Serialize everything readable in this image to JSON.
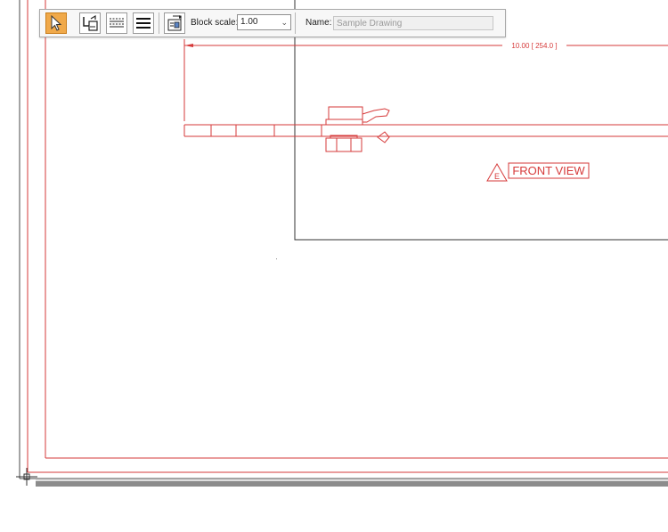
{
  "toolbar": {
    "select_tool_icon": "arrow-cursor-icon",
    "insert_block_icon": "insert-block-icon",
    "dashed_lines_icon": "dashed-lines-icon",
    "solid_lines_icon": "solid-lines-icon",
    "block_properties_icon": "block-properties-icon",
    "block_scale_label": "Block scale:",
    "block_scale_value": "1.00",
    "name_label": "Name:",
    "name_placeholder": "Sample Drawing"
  },
  "drawing": {
    "dimension_text": "10.00 [ 254.0 ]",
    "view_symbol_letter": "E",
    "view_title": "FRONT VIEW"
  },
  "colors": {
    "drawing_red": "#d63a3a",
    "outline_dark": "#333333",
    "tool_active": "#f0a94a"
  }
}
